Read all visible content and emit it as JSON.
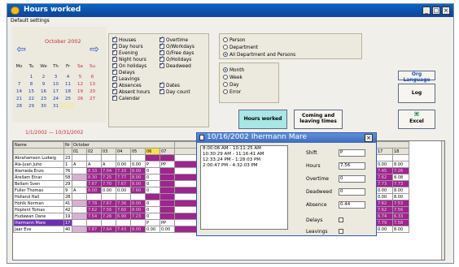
{
  "window": {
    "title": "Hours worked",
    "min": "_",
    "max": "□",
    "close": "×"
  },
  "menu": {
    "label": "Default settings"
  },
  "calendar": {
    "month_label": "October 2002",
    "prev_icon": "left-arrow-icon",
    "next_icon": "right-arrow-icon",
    "weekdays": [
      "Mo",
      "Tu",
      "We",
      "Th",
      "Fr",
      "Sa",
      "Su"
    ],
    "weeks": [
      [
        "",
        "1",
        "2",
        "3",
        "4",
        "5",
        "6"
      ],
      [
        "7",
        "8",
        "9",
        "10",
        "11",
        "12",
        "13"
      ],
      [
        "14",
        "15",
        "16",
        "17",
        "18",
        "19",
        "20"
      ],
      [
        "21",
        "22",
        "23",
        "24",
        "25",
        "26",
        "27"
      ],
      [
        "28",
        "29",
        "30",
        "31",
        "",
        "",
        ""
      ]
    ],
    "range": "1/1/2002  —  10/31/2002"
  },
  "options": {
    "col1": [
      {
        "label": "Houses",
        "checked": true
      },
      {
        "label": "Day hours",
        "checked": true
      },
      {
        "label": "Evening",
        "checked": true
      },
      {
        "label": "Night hours",
        "checked": true
      },
      {
        "label": "On holidays",
        "checked": true
      },
      {
        "label": "Delays",
        "checked": true
      },
      {
        "label": "Leavings",
        "checked": true
      },
      {
        "label": "Absences",
        "checked": true
      },
      {
        "label": "Absent hours",
        "checked": true
      },
      {
        "label": "Calendar",
        "checked": true
      }
    ],
    "col2": [
      {
        "label": "Overtime",
        "checked": true
      },
      {
        "label": "O/Workdays",
        "checked": true
      },
      {
        "label": "O/Free days",
        "checked": true
      },
      {
        "label": "O/Holidays",
        "checked": true
      },
      {
        "label": "Deadweed",
        "checked": true
      }
    ],
    "col2b": [
      {
        "label": "Dates",
        "checked": true
      },
      {
        "label": "Day count",
        "checked": true
      }
    ]
  },
  "scope": [
    {
      "label": "Person",
      "on": false
    },
    {
      "label": "Department",
      "on": false
    },
    {
      "label": "All Department and Persons",
      "on": true
    }
  ],
  "period": [
    {
      "label": "Month",
      "on": true
    },
    {
      "label": "Week",
      "on": false
    },
    {
      "label": "Day",
      "on": false
    },
    {
      "label": "Error",
      "on": false
    }
  ],
  "buttons": {
    "lang": "Org Language",
    "log": "Log",
    "hours_worked": "Hours worked",
    "coming_leaving": "Coming and leaving times",
    "excel_icon": "excel-icon",
    "excel": "Excel"
  },
  "grid": {
    "header_name": "Name",
    "header_nr": "Nr",
    "month": "October",
    "days": [
      "01",
      "02",
      "03",
      "04",
      "05",
      "06",
      "07"
    ],
    "right_days": [
      "16",
      "17",
      "18"
    ],
    "rows": [
      {
        "name": "Abrahamson Ludwig",
        "nr": "23",
        "cells": [
          "",
          "",
          "",
          "",
          "",
          "",
          ""
        ],
        "right": [
          "",
          "",
          ""
        ]
      },
      {
        "name": "Ala-Juan Juho",
        "nr": "1",
        "cells": [
          "A",
          "A",
          "A",
          "0.00",
          "0.00",
          "P",
          "PP"
        ],
        "right": [
          "0.00",
          "0.00",
          "8.00"
        ]
      },
      {
        "name": "Alameda Enzo",
        "nr": "76",
        "cells": [
          "",
          "8.33",
          "7.04",
          "7.10",
          "8.00",
          "0",
          ""
        ],
        "right": [
          "7.53",
          "7.45",
          "7.26"
        ]
      },
      {
        "name": "Arellam Einar",
        "nr": "58",
        "cells": [
          "",
          "8.30",
          "7.25",
          "7.77",
          "8.00",
          "0",
          ""
        ],
        "right": [
          "7.70",
          "7.62",
          "8.08"
        ]
      },
      {
        "name": "Bellam Sven",
        "nr": "29",
        "cells": [
          "",
          "7.67",
          "7.70",
          "7.67",
          "8.00",
          "0",
          ""
        ],
        "right": [
          "7.62",
          "7.73",
          "7.73"
        ]
      },
      {
        "name": "Fuller Thomas",
        "nr": "9",
        "cells": [
          "A",
          "8.00",
          "0.00",
          "0.00",
          "7.60",
          "0",
          ""
        ],
        "right": [
          "0.00",
          "0.00",
          "8.00"
        ]
      },
      {
        "name": "Holland Hall",
        "nr": "28",
        "cells": [
          "",
          "",
          "",
          "",
          "",
          "",
          ""
        ],
        "right": [
          "0.00",
          "0.00",
          "8.00"
        ]
      },
      {
        "name": "Hohlk Norman",
        "nr": "41",
        "cells": [
          "",
          "7.78",
          "7.67",
          "7.36",
          "8.00",
          "0",
          ""
        ],
        "right": [
          "7.87",
          "7.62",
          "7.53"
        ]
      },
      {
        "name": "Hoplent Tomas",
        "nr": "42",
        "cells": [
          "",
          "7.62",
          "7.56",
          "7.60",
          "8.00",
          "0",
          ""
        ],
        "right": [
          "7.58",
          "7.62",
          "7.56"
        ]
      },
      {
        "name": "Hudawan Dane",
        "nr": "19",
        "cells": [
          "",
          "7.54",
          "7.26",
          "6.90",
          "7.23",
          "0",
          ""
        ],
        "right": [
          "6.90",
          "6.74",
          "6.33"
        ]
      },
      {
        "name": "Ihermann Mare",
        "nr": "17",
        "cells": [
          "",
          "",
          "",
          "",
          "",
          "P",
          "PP"
        ],
        "right": [
          "7.96",
          "7.79",
          "7.58"
        ]
      },
      {
        "name": "Jaar Eve",
        "nr": "40",
        "cells": [
          "",
          "7.87",
          "7.64",
          "7.43",
          "8.00",
          "0.00",
          "0.00"
        ],
        "right": [
          "0.00",
          "0.00",
          "8.00"
        ]
      }
    ]
  },
  "dialog": {
    "title": "10/16/2002   Ihermann Mare",
    "close": "×",
    "entries": [
      "8:00:06 AM - 10:11:25 AM",
      "10:30:29 AM - 11:16:41 AM",
      "12:33:24 PM - 1:28:03 PM",
      "2:00:47 PM - 4:32:03 PM"
    ],
    "fields": [
      {
        "label": "Shift",
        "value": "P"
      },
      {
        "label": "Hours",
        "value": "7.56"
      },
      {
        "label": "Overtime",
        "value": "0"
      },
      {
        "label": "Deadweed",
        "value": "0"
      },
      {
        "label": "Absence",
        "value": "0.44"
      }
    ],
    "checks": [
      {
        "label": "Delays",
        "checked": false
      },
      {
        "label": "Leavings",
        "checked": false
      }
    ]
  },
  "colors": {
    "magenta": "#a0238f",
    "purple": "#6f2fb3",
    "yellow": "#f3e24a",
    "lightpurple": "#d8b0d5"
  }
}
